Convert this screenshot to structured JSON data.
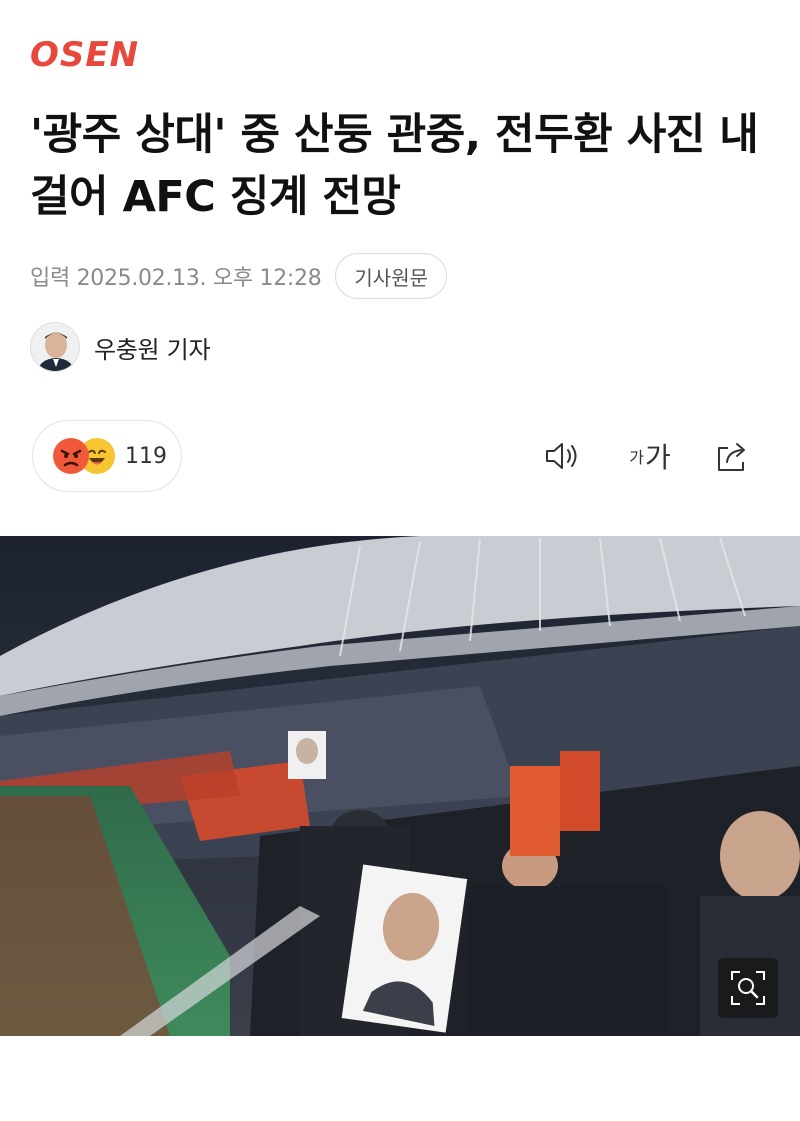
{
  "brand": {
    "logo_text": "OSEN",
    "color": "#e8483c"
  },
  "article": {
    "headline": "'광주 상대' 중 산둥 관중, 전두환 사진 내걸어 AFC 징계 전망",
    "date": "입력 2025.02.13. 오후 12:28",
    "source_button": "기사원문",
    "author": "우충원 기자"
  },
  "reactions": {
    "count": "119",
    "icons": [
      "angry-emoji",
      "laugh-emoji"
    ]
  },
  "toolbar": {
    "speaker_icon": "speaker-icon",
    "font_small": "가",
    "font_large": "가",
    "share_icon": "share-icon"
  },
  "photo": {
    "zoom_icon": "zoom-icon"
  }
}
